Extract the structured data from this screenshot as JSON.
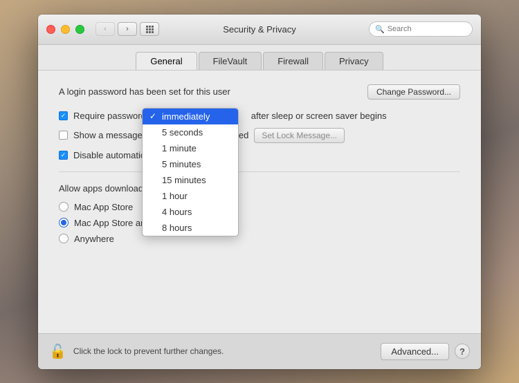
{
  "background": {
    "gradient": "mountain landscape"
  },
  "titlebar": {
    "title": "Security & Privacy",
    "back_disabled": true,
    "forward_disabled": false,
    "search_placeholder": "Search"
  },
  "tabs": [
    {
      "label": "General",
      "active": true
    },
    {
      "label": "FileVault",
      "active": false
    },
    {
      "label": "Firewall",
      "active": false
    },
    {
      "label": "Privacy",
      "active": false
    }
  ],
  "content": {
    "login_text": "A login password has been set for this user",
    "change_password_label": "Change Password...",
    "require_password": {
      "label_before": "Require password",
      "label_after": "after sleep or screen saver begins",
      "checked": true
    },
    "show_message": {
      "label": "Show a message when the screen is locked",
      "checked": false
    },
    "set_lock_label": "Set Lock Message...",
    "disable_auto": {
      "label": "Disable automatic login",
      "checked": true
    },
    "dropdown": {
      "selected": "immediately",
      "items": [
        {
          "value": "immediately",
          "label": "immediately",
          "selected": true
        },
        {
          "value": "5seconds",
          "label": "5 seconds",
          "selected": false
        },
        {
          "value": "1minute",
          "label": "1 minute",
          "selected": false
        },
        {
          "value": "5minutes",
          "label": "5 minutes",
          "selected": false
        },
        {
          "value": "15minutes",
          "label": "15 minutes",
          "selected": false
        },
        {
          "value": "1hour",
          "label": "1 hour",
          "selected": false
        },
        {
          "value": "4hours",
          "label": "4 hours",
          "selected": false
        },
        {
          "value": "8hours",
          "label": "8 hours",
          "selected": false
        }
      ]
    },
    "allow_apps_label": "Allow apps downloaded from:",
    "radio_options": [
      {
        "label": "Mac App Store",
        "selected": false
      },
      {
        "label": "Mac App Store and identified developers",
        "selected": true
      },
      {
        "label": "Anywhere",
        "selected": false
      }
    ]
  },
  "footer": {
    "lock_text": "Click the lock to prevent further changes.",
    "advanced_label": "Advanced...",
    "help_label": "?"
  }
}
